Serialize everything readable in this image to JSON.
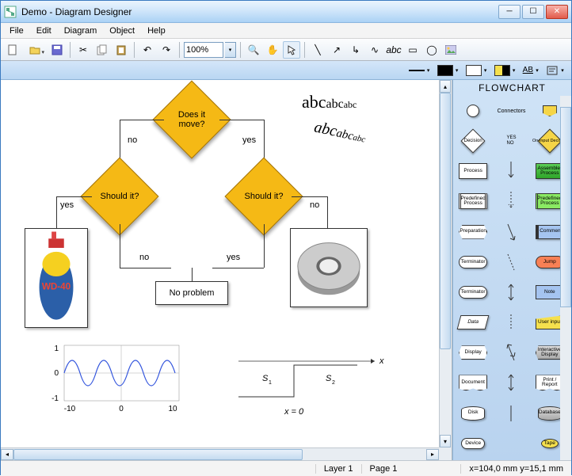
{
  "window": {
    "title": "Demo - Diagram Designer"
  },
  "menu": {
    "file": "File",
    "edit": "Edit",
    "diagram": "Diagram",
    "object": "Object",
    "help": "Help"
  },
  "toolbar": {
    "zoom": "100%",
    "text_sample": "abc"
  },
  "format": {
    "line_color": "#000000",
    "fill_color": "#ffffff",
    "fill2_color": "#fff04d",
    "text_sample": "AB"
  },
  "flowchart": {
    "nodes": {
      "root": "Does it\nmove?",
      "left": "Should it?",
      "right": "Should it?",
      "result": "No problem"
    },
    "edges": {
      "no": "no",
      "yes": "yes"
    },
    "image_left_alt": "WD-40",
    "image_right_alt": "Duct tape"
  },
  "decorations": {
    "bigtext1": "abc",
    "bigtext2": "abc",
    "bigtext3": "abc",
    "rot1": "abc",
    "rot2": "abc",
    "rot3": "abc"
  },
  "graph": {
    "y_ticks": [
      "1",
      "0",
      "-1"
    ],
    "x_ticks": [
      "-10",
      "0",
      "10"
    ],
    "labels": {
      "s1": "S",
      "s1_sub": "1",
      "s2": "S",
      "s2_sub": "2",
      "x": "x",
      "xeq": "x = 0"
    }
  },
  "palette": {
    "title": "FLOWCHART",
    "conn_label": "Connectors",
    "yes": "YES",
    "no": "NO",
    "items": [
      "",
      "Connectors",
      "",
      "Decision",
      "",
      "On-input Decision",
      "Process",
      "",
      "Assembler Process",
      "Predefined Process",
      "",
      "Predefined Process",
      "Preparation",
      "",
      "Comment",
      "Terminator",
      "",
      "Jump",
      "Terminator",
      "",
      "Note",
      "Data",
      "",
      "User input",
      "Display",
      "",
      "Interactive Display",
      "Document",
      "",
      "Print / Report",
      "Disk",
      "",
      "Database",
      "Device",
      "",
      "Tape"
    ]
  },
  "status": {
    "layer": "Layer 1",
    "page": "Page 1",
    "coords": "x=104,0 mm  y=15,1 mm"
  }
}
